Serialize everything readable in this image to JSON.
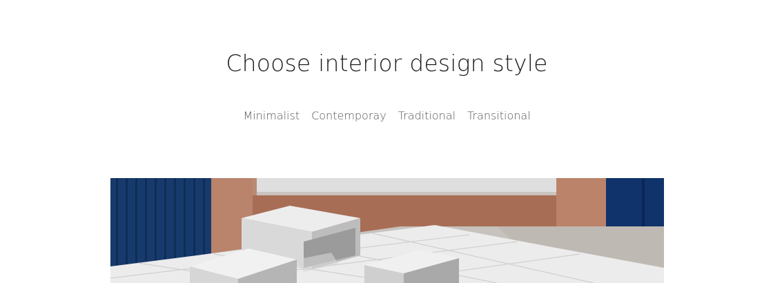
{
  "heading": "Choose interior design style",
  "style_tabs": [
    {
      "label": "Minimalist"
    },
    {
      "label": "Contemporay"
    },
    {
      "label": "Traditional"
    },
    {
      "label": "Transitional"
    }
  ],
  "colors": {
    "navy": "#133a74",
    "terracotta": "#b27a64",
    "concrete": "#c9c5c0",
    "block": "#e6e6e6"
  },
  "hero_image": {
    "icon": "interior-photo"
  }
}
